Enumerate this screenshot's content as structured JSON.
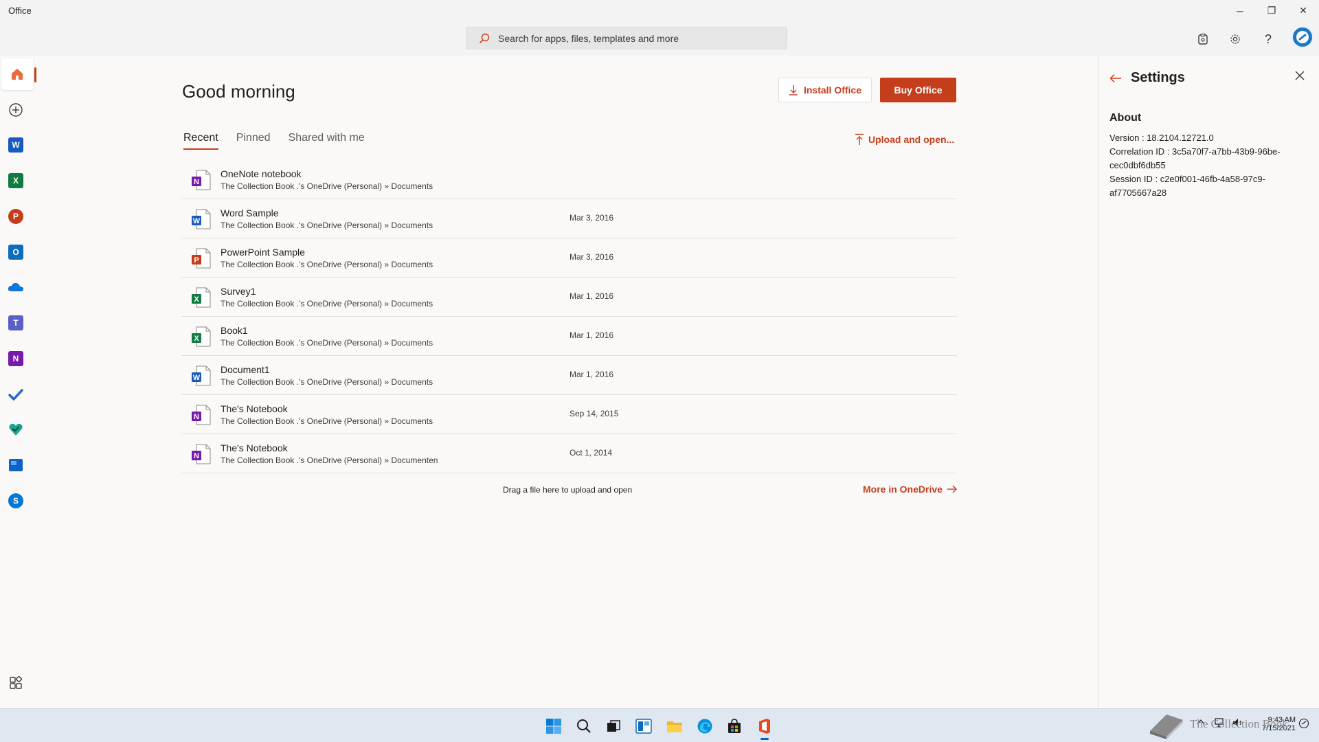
{
  "window": {
    "title": "Office",
    "controls": {
      "minimize": "─",
      "restore": "❐",
      "close": "✕"
    }
  },
  "topbar": {
    "search_placeholder": "Search for apps, files, templates and more",
    "icons": [
      "feedback-icon",
      "gear-icon",
      "help-icon",
      "account-icon"
    ],
    "help_glyph": "?"
  },
  "rail": {
    "items": [
      {
        "name": "home",
        "active": true
      },
      {
        "name": "create",
        "glyph": "+"
      },
      {
        "name": "word",
        "letter": "W",
        "color": "#185abd"
      },
      {
        "name": "excel",
        "letter": "X",
        "color": "#107c41"
      },
      {
        "name": "powerpoint",
        "letter": "P",
        "color": "#c43e1c"
      },
      {
        "name": "outlook",
        "letter": "O",
        "color": "#0f6cbd"
      },
      {
        "name": "onedrive"
      },
      {
        "name": "teams",
        "letter": "T",
        "color": "#5b5fc7"
      },
      {
        "name": "onenote",
        "letter": "N",
        "color": "#7719aa"
      },
      {
        "name": "todo"
      },
      {
        "name": "family-safety"
      },
      {
        "name": "whiteboard"
      },
      {
        "name": "skype",
        "letter": "S",
        "color": "#0078d4"
      }
    ],
    "bottom": "all-apps"
  },
  "main": {
    "greeting": "Good morning",
    "install_label": "Install Office",
    "buy_label": "Buy Office",
    "tabs": [
      {
        "label": "Recent",
        "active": true
      },
      {
        "label": "Pinned",
        "active": false
      },
      {
        "label": "Shared with me",
        "active": false
      }
    ],
    "upload_label": "Upload and open...",
    "files": [
      {
        "name": "OneNote notebook",
        "path": "The Collection Book .'s OneDrive (Personal) » Documents",
        "date": "",
        "app": "onenote",
        "letter": "N",
        "color": "#7719aa"
      },
      {
        "name": "Word Sample",
        "path": "The Collection Book .'s OneDrive (Personal) » Documents",
        "date": "Mar 3, 2016",
        "app": "word",
        "letter": "W",
        "color": "#185abd"
      },
      {
        "name": "PowerPoint Sample",
        "path": "The Collection Book .'s OneDrive (Personal) » Documents",
        "date": "Mar 3, 2016",
        "app": "powerpoint",
        "letter": "P",
        "color": "#c43e1c"
      },
      {
        "name": "Survey1",
        "path": "The Collection Book .'s OneDrive (Personal) » Documents",
        "date": "Mar 1, 2016",
        "app": "excel",
        "letter": "X",
        "color": "#107c41"
      },
      {
        "name": "Book1",
        "path": "The Collection Book .'s OneDrive (Personal) » Documents",
        "date": "Mar 1, 2016",
        "app": "excel",
        "letter": "X",
        "color": "#107c41"
      },
      {
        "name": "Document1",
        "path": "The Collection Book .'s OneDrive (Personal) » Documents",
        "date": "Mar 1, 2016",
        "app": "word",
        "letter": "W",
        "color": "#185abd"
      },
      {
        "name": "The's Notebook",
        "path": "The Collection Book .'s OneDrive (Personal) » Documents",
        "date": "Sep 14, 2015",
        "app": "onenote",
        "letter": "N",
        "color": "#7719aa"
      },
      {
        "name": "The's Notebook",
        "path": "The Collection Book .'s OneDrive (Personal) » Documenten",
        "date": "Oct 1, 2014",
        "app": "onenote",
        "letter": "N",
        "color": "#7719aa"
      }
    ],
    "drag_note": "Drag a file here to upload and open",
    "more_label": "More in OneDrive"
  },
  "settings": {
    "title": "Settings",
    "about_heading": "About",
    "version": "Version : 18.2104.12721.0",
    "correlation": "Correlation ID : 3c5a70f7-a7bb-43b9-96be-cec0dbf6db55",
    "session": "Session ID : c2e0f001-46fb-4a58-97c9-af7705667a28"
  },
  "taskbar": {
    "apps": [
      "start-icon",
      "search-icon",
      "task-view-icon",
      "widgets-icon",
      "file-explorer-icon",
      "edge-icon",
      "store-icon",
      "office-icon"
    ],
    "active": "office-icon",
    "clock_time": "9:43 AM",
    "clock_date": "7/15/2021",
    "watermark": "The Collection Book"
  },
  "colors": {
    "accent": "#c43e1c",
    "background": "#faf9f8",
    "taskbar": "#dfe7f1"
  }
}
